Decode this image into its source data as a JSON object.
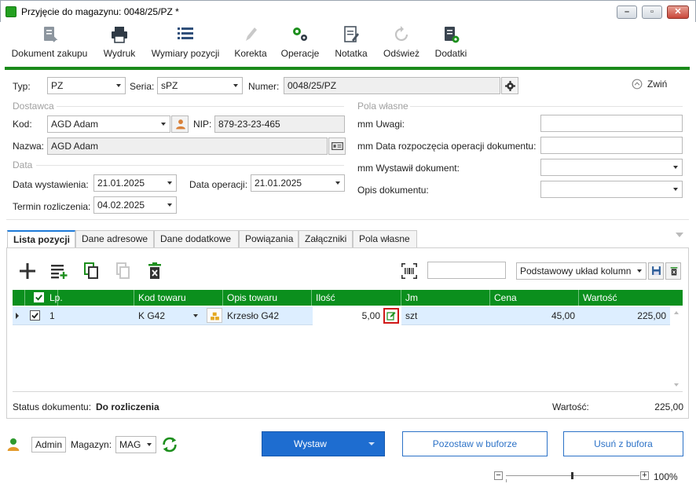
{
  "window": {
    "title": "Przyjęcie do magazynu: 0048/25/PZ *",
    "controls": [
      "minimize-icon",
      "maximize-icon",
      "close-icon"
    ]
  },
  "toolbar": [
    {
      "label": "Dokument zakupu",
      "icon": "document-arrow-icon",
      "enabled": true
    },
    {
      "label": "Wydruk",
      "icon": "printer-icon",
      "enabled": true
    },
    {
      "label": "Wymiary pozycji",
      "icon": "list-icon",
      "enabled": true
    },
    {
      "label": "Korekta",
      "icon": "pencil-icon",
      "enabled": false
    },
    {
      "label": "Operacje",
      "icon": "gears-icon",
      "enabled": true
    },
    {
      "label": "Notatka",
      "icon": "note-icon",
      "enabled": true
    },
    {
      "label": "Odśwież",
      "icon": "refresh-icon",
      "enabled": false
    },
    {
      "label": "Dodatki",
      "icon": "addons-icon",
      "enabled": true
    }
  ],
  "header": {
    "typ_label": "Typ:",
    "typ_value": "PZ",
    "seria_label": "Seria:",
    "seria_value": "sPZ",
    "numer_label": "Numer:",
    "numer_value": "0048/25/PZ",
    "collapse_label": "Zwiń"
  },
  "dostawca": {
    "section": "Dostawca",
    "kod_label": "Kod:",
    "kod_value": "AGD Adam",
    "nip_label": "NIP:",
    "nip_value": "879-23-23-465",
    "nazwa_label": "Nazwa:",
    "nazwa_value": "AGD Adam"
  },
  "data": {
    "section": "Data",
    "wystawienia_label": "Data wystawienia:",
    "wystawienia_value": "21.01.2025",
    "operacji_label": "Data operacji:",
    "operacji_value": "21.01.2025",
    "termin_label": "Termin rozliczenia:",
    "termin_value": "04.02.2025"
  },
  "pola_wlasne": {
    "section": "Pola własne",
    "fields": [
      {
        "label": "mm Uwagi:",
        "value": "",
        "type": "text"
      },
      {
        "label": "mm Data rozpoczęcia operacji dokumentu:",
        "value": "",
        "type": "text"
      },
      {
        "label": "mm Wystawił dokument:",
        "value": "",
        "type": "select"
      },
      {
        "label": "Opis dokumentu:",
        "value": "",
        "type": "select"
      }
    ]
  },
  "tabs": [
    "Lista pozycji",
    "Dane adresowe",
    "Dane dodatkowe",
    "Powiązania",
    "Załączniki",
    "Pola własne"
  ],
  "active_tab": "Lista pozycji",
  "grid_toolbar": {
    "layout_value": "Podstawowy układ kolumn",
    "search_value": ""
  },
  "grid": {
    "columns": [
      "Lp.",
      "Kod towaru",
      "Opis towaru",
      "Ilość",
      "Jm",
      "Cena",
      "Wartość"
    ],
    "rows": [
      {
        "lp": "1",
        "kod": "K G42",
        "opis": "Krzesło G42",
        "ilosc": "5,00",
        "jm": "szt",
        "cena": "45,00",
        "wartosc": "225,00",
        "checked": true
      }
    ]
  },
  "status": {
    "label": "Status dokumentu:",
    "value": "Do rozliczenia",
    "wartosc_label": "Wartość:",
    "wartosc_value": "225,00"
  },
  "footer": {
    "user": "Admin",
    "magazyn_label": "Magazyn:",
    "magazyn_value": "MAG",
    "wystaw_label": "Wystaw",
    "bufor_label": "Pozostaw w buforze",
    "usun_label": "Usuń z bufora",
    "zoom_minus": "−",
    "zoom_plus": "+",
    "zoom_value": "100%"
  },
  "colors": {
    "accent_green": "#0b8f1d",
    "primary_blue": "#1e6dd0",
    "row_highlight": "#ddeeff"
  }
}
